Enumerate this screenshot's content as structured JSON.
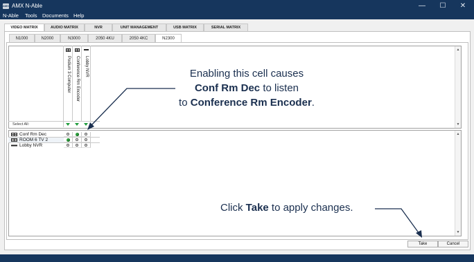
{
  "window": {
    "title": "AMX N-Able",
    "logo_text": "AMX"
  },
  "menu": [
    "N-Able",
    "Tools",
    "Documents",
    "Help"
  ],
  "top_tabs": [
    "VIDEO MATRIX",
    "AUDIO MATRIX",
    "NVR",
    "UNIT MANAGEMENT",
    "USB MATRIX",
    "SERIAL MATRIX"
  ],
  "top_tab_active": "VIDEO MATRIX",
  "sub_tabs": [
    "N1000",
    "N2000",
    "N3000",
    "2050 4KU",
    "2050 4KC",
    "N2300"
  ],
  "sub_tab_active": "N2300",
  "columns": [
    "Podium 3 Computer",
    "Conference Rm Encoder",
    "Lobby NVR"
  ],
  "select_all_label": "Select All:",
  "rows": [
    {
      "label": "Conf Rm Dec",
      "cells": [
        "off",
        "on",
        "off"
      ]
    },
    {
      "label": "ROOM 6 TV 2",
      "cells": [
        "on",
        "off",
        "off"
      ]
    },
    {
      "label": "Lobby NVR",
      "cells": [
        "off",
        "off",
        "off"
      ]
    }
  ],
  "callout_top": {
    "line1": "Enabling this cell causes",
    "line2_bold": "Conf Rm Dec",
    "line2_rest": " to listen",
    "line3_prefix": "to ",
    "line3_bold": "Conference Rm Encoder",
    "line3_suffix": "."
  },
  "callout_bottom": {
    "prefix": "Click ",
    "bold": "Take",
    "suffix": " to apply changes."
  },
  "buttons": {
    "take": "Take",
    "cancel": "Cancel"
  },
  "window_controls": {
    "minimize": "—",
    "maximize": "☐",
    "close": "✕"
  }
}
